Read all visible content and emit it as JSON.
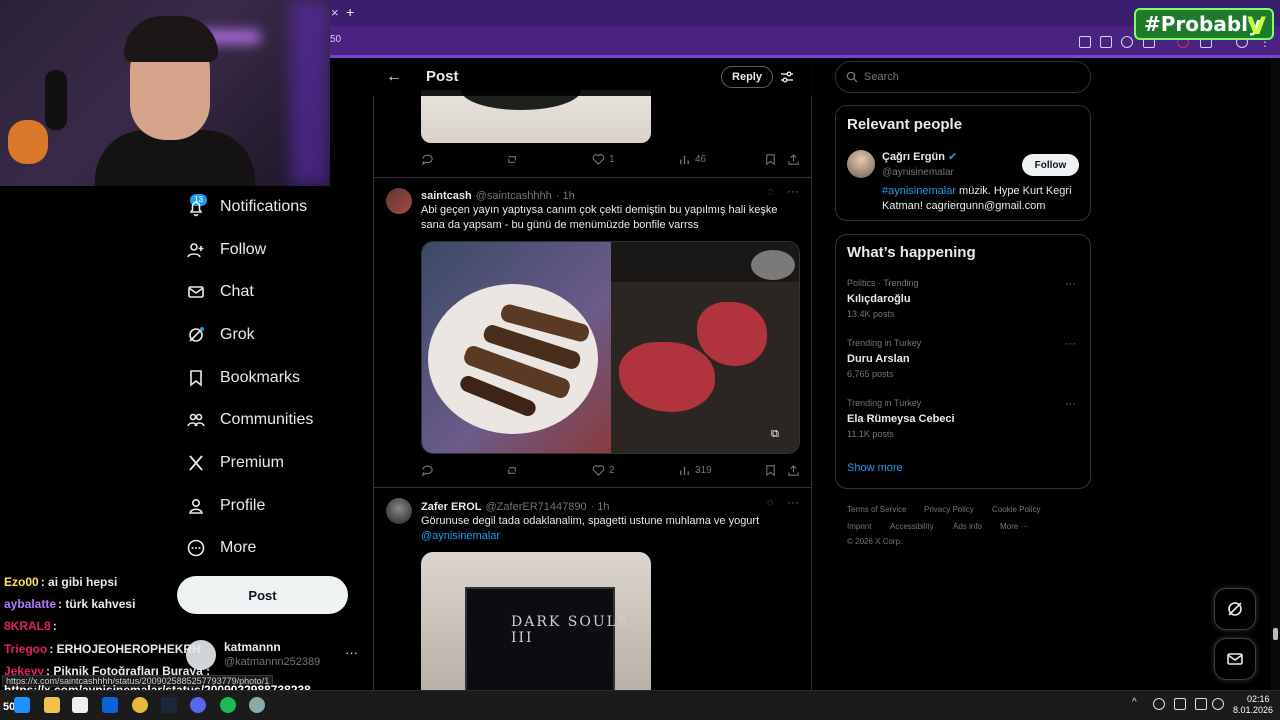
{
  "browser": {
    "address": "50",
    "overlay_badge": "#Probably"
  },
  "nav": {
    "notifications_badge": "13",
    "items": [
      {
        "label": "Notifications",
        "icon": "bell-icon"
      },
      {
        "label": "Follow",
        "icon": "person-add-icon"
      },
      {
        "label": "Chat",
        "icon": "mail-icon"
      },
      {
        "label": "Grok",
        "icon": "grok-icon"
      },
      {
        "label": "Bookmarks",
        "icon": "bookmark-icon"
      },
      {
        "label": "Communities",
        "icon": "communities-icon"
      },
      {
        "label": "Premium",
        "icon": "x-logo-icon"
      },
      {
        "label": "Profile",
        "icon": "person-icon"
      },
      {
        "label": "More",
        "icon": "more-circle-icon"
      }
    ],
    "post_button": "Post",
    "account": {
      "name": "katmannn",
      "handle": "@katmannn252389",
      "more": "···"
    }
  },
  "chat_overlay": [
    {
      "user": "Ezo00",
      "text": ": ai gibi hepsi",
      "color": "#ffe066"
    },
    {
      "user": "aybalatte",
      "text": ": türk kahvesi",
      "color": "#b07cff"
    },
    {
      "user": "8KRAL8",
      "text": ":",
      "color": "#e0245e"
    },
    {
      "user": "Triegoo",
      "text": ": ERHOJEOHEROPHEKRH",
      "color": "#e0245e"
    },
    {
      "user": "Jekeyy",
      "text": ": Piknik Fotoğrafları Buraya :",
      "color": "#e0245e"
    }
  ],
  "url_tooltip": "https://x.com/saintcashhhh/status/2009025885257793779/photo/1",
  "url_overlay": "https://x.com/aynisinemalar/status/2009022988738238",
  "post_page": {
    "title": "Post",
    "reply_button": "Reply",
    "tweet1_actions": {
      "replies": "",
      "retweets": "",
      "likes": "1",
      "views": "46"
    },
    "tweet2": {
      "name": "saintcash",
      "handle": "@saintcashhhh",
      "time": "· 1h",
      "text": "Abi geçen yayın yaptıysa canım çok çekti demiştin bu yapılmış hali keşke sana da yapsam - bu günü de menümüzde bonfile varrss",
      "likes": "2",
      "views": "319"
    },
    "tweet3": {
      "name": "Zafer EROL",
      "handle": "@ZaferER71447890",
      "time": "· 1h",
      "text": "Görunuse degil tada odaklanalim, spagetti ustune muhlama ve yogurt",
      "mention": "@aynisinemalar",
      "media_text": "DARK SOULS III"
    }
  },
  "search": {
    "placeholder": "Search"
  },
  "relevant_people": {
    "title": "Relevant people",
    "name": "Çağrı Ergün",
    "handle": "@aynisinemalar",
    "bio_mention": "#aynisinemalar",
    "bio": " müzik. Hype Kurt Kegri Katman! cagriergunn@gmail.com",
    "follow_button": "Follow"
  },
  "whats_happening": {
    "title": "What’s happening",
    "trends": [
      {
        "meta": "Politics · Trending",
        "name": "Kılıçdaroğlu",
        "posts": "13.4K posts"
      },
      {
        "meta": "Trending in Turkey",
        "name": "Duru Arslan",
        "posts": "6,765 posts"
      },
      {
        "meta": "Trending in Turkey",
        "name": "Ela Rümeysa Cebeci",
        "posts": "11.1K posts"
      }
    ],
    "show_more": "Show more"
  },
  "footer": {
    "links": [
      "Terms of Service",
      "Privacy Policy",
      "Cookie Policy",
      "Imprint",
      "Accessibility",
      "Ads info",
      "More ···"
    ],
    "copyright": "© 2026 X Corp."
  },
  "taskbar": {
    "time": "02:16",
    "date": "8.01.2026",
    "number": "50"
  }
}
